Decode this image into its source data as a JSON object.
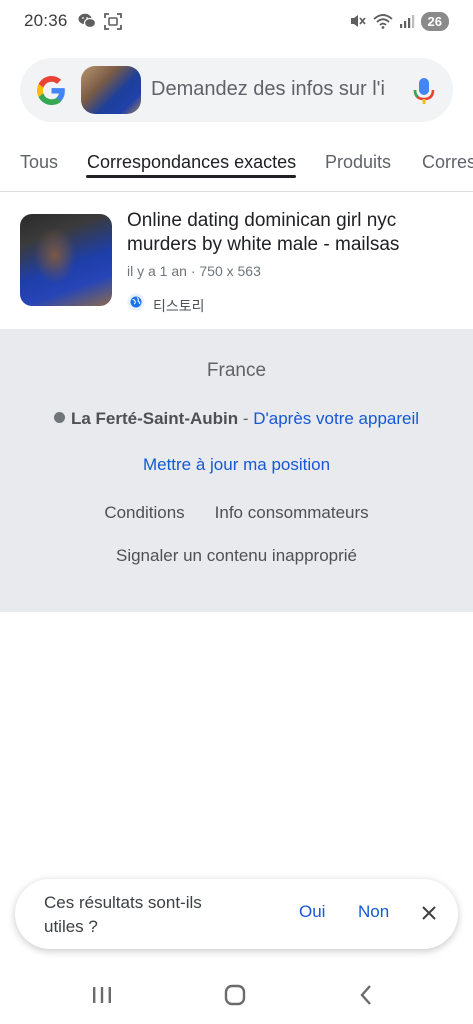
{
  "status_bar": {
    "time": "20:36",
    "battery": "26",
    "icons": [
      "wechat-icon",
      "screenshot-icon",
      "mute-icon",
      "wifi-icon",
      "signal-icon"
    ]
  },
  "search": {
    "placeholder": "Demandez des infos sur l'i"
  },
  "tabs": [
    {
      "label": "Tous"
    },
    {
      "label": "Correspondances exactes",
      "active": true
    },
    {
      "label": "Produits"
    },
    {
      "label": "Corres"
    }
  ],
  "result": {
    "title": "Online dating dominican girl nyc murders by white male - mailsas",
    "meta": "il y a 1 an · 750 x 563",
    "source": "티스토리"
  },
  "footer": {
    "country": "France",
    "location": "La Ferté-Saint-Aubin",
    "location_separator": " - ",
    "location_source": "D'après votre appareil",
    "update_position": "Mettre à jour ma position",
    "conditions": "Conditions",
    "consumer_info": "Info consommateurs",
    "report": "Signaler un contenu inapproprié"
  },
  "feedback": {
    "question": "Ces résultats sont-ils utiles ?",
    "yes": "Oui",
    "no": "Non"
  },
  "colors": {
    "link_blue": "#1558d6",
    "footer_bg": "#e8eaed",
    "search_bg": "#f1f3f4",
    "google_blue": "#4285F4",
    "google_red": "#EA4335",
    "google_yellow": "#FBBC05",
    "google_green": "#34A853"
  }
}
